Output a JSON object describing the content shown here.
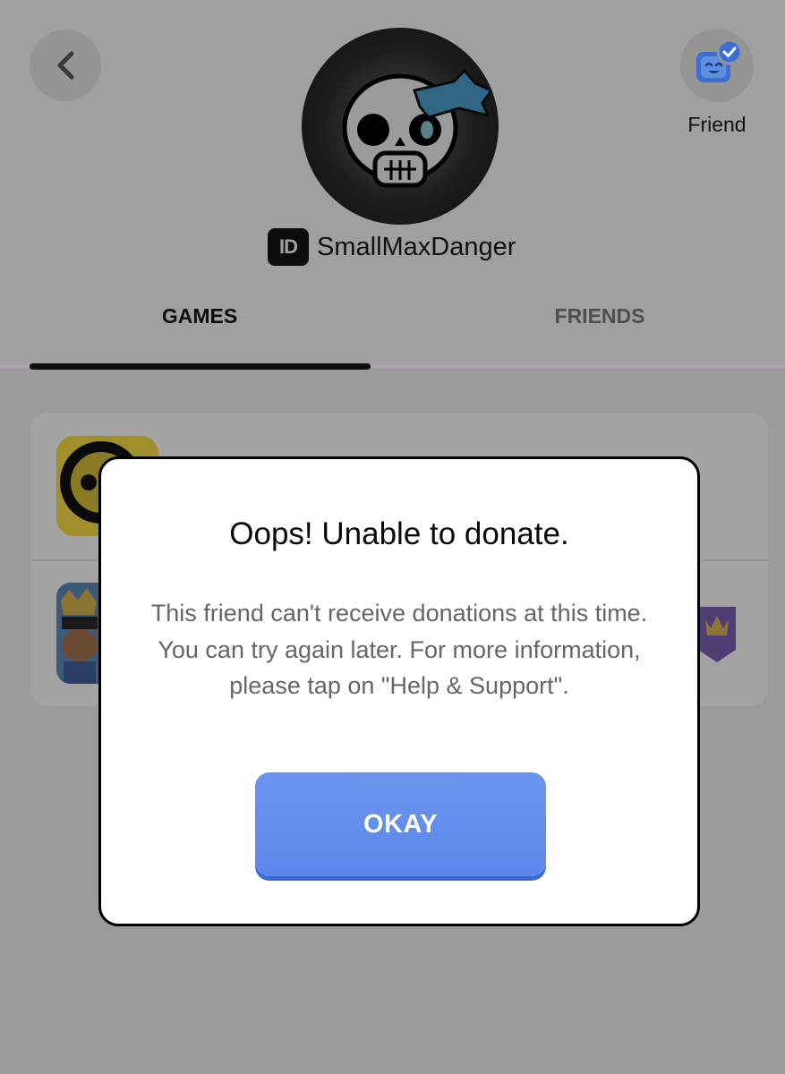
{
  "profile": {
    "username": "SmallMaxDanger",
    "id_badge": "ID",
    "friend_label": "Friend",
    "avatar_icon": "skull-avatar-icon"
  },
  "tabs": [
    {
      "label": "GAMES",
      "active": true
    },
    {
      "label": "FRIENDS",
      "active": false
    }
  ],
  "games": [
    {
      "icon": "brawl-stars-icon"
    },
    {
      "icon": "clash-royale-icon",
      "badge": "crown-badge-icon"
    }
  ],
  "dialog": {
    "title": "Oops! Unable to donate.",
    "message": "This friend can't receive donations at this time. You can try again later. For more information, please tap on \"Help & Support\".",
    "button_label": "OKAY"
  },
  "colors": {
    "primary_button": "#5c86ea",
    "dim_overlay": "#9b9b9b",
    "friend_check": "#3d6ed8"
  }
}
